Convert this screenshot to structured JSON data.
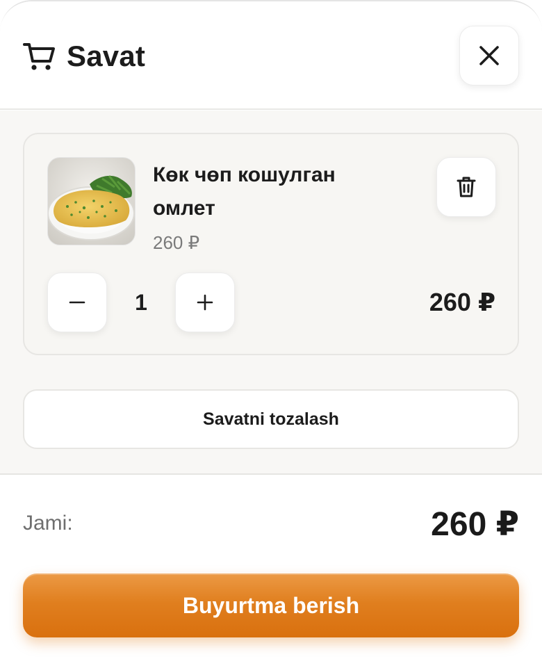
{
  "header": {
    "title": "Savat",
    "cart_icon": "cart-icon",
    "close_icon": "close-icon"
  },
  "cart": {
    "items": [
      {
        "name": "Көк чөп кошулган омлет",
        "unit_price": "260 ₽",
        "quantity": "1",
        "line_total": "260 ₽",
        "image": "omelet-with-greens",
        "minus_icon": "minus-icon",
        "plus_icon": "plus-icon",
        "delete_icon": "trash-icon"
      }
    ],
    "clear_label": "Savatni tozalash"
  },
  "footer": {
    "total_label": "Jami:",
    "total_value": "260 ₽",
    "checkout_label": "Buyurtma berish"
  },
  "colors": {
    "accent": "#e07f1f",
    "background": "#f8f7f5",
    "text": "#1c1c1c",
    "muted": "#7a7a7a"
  }
}
